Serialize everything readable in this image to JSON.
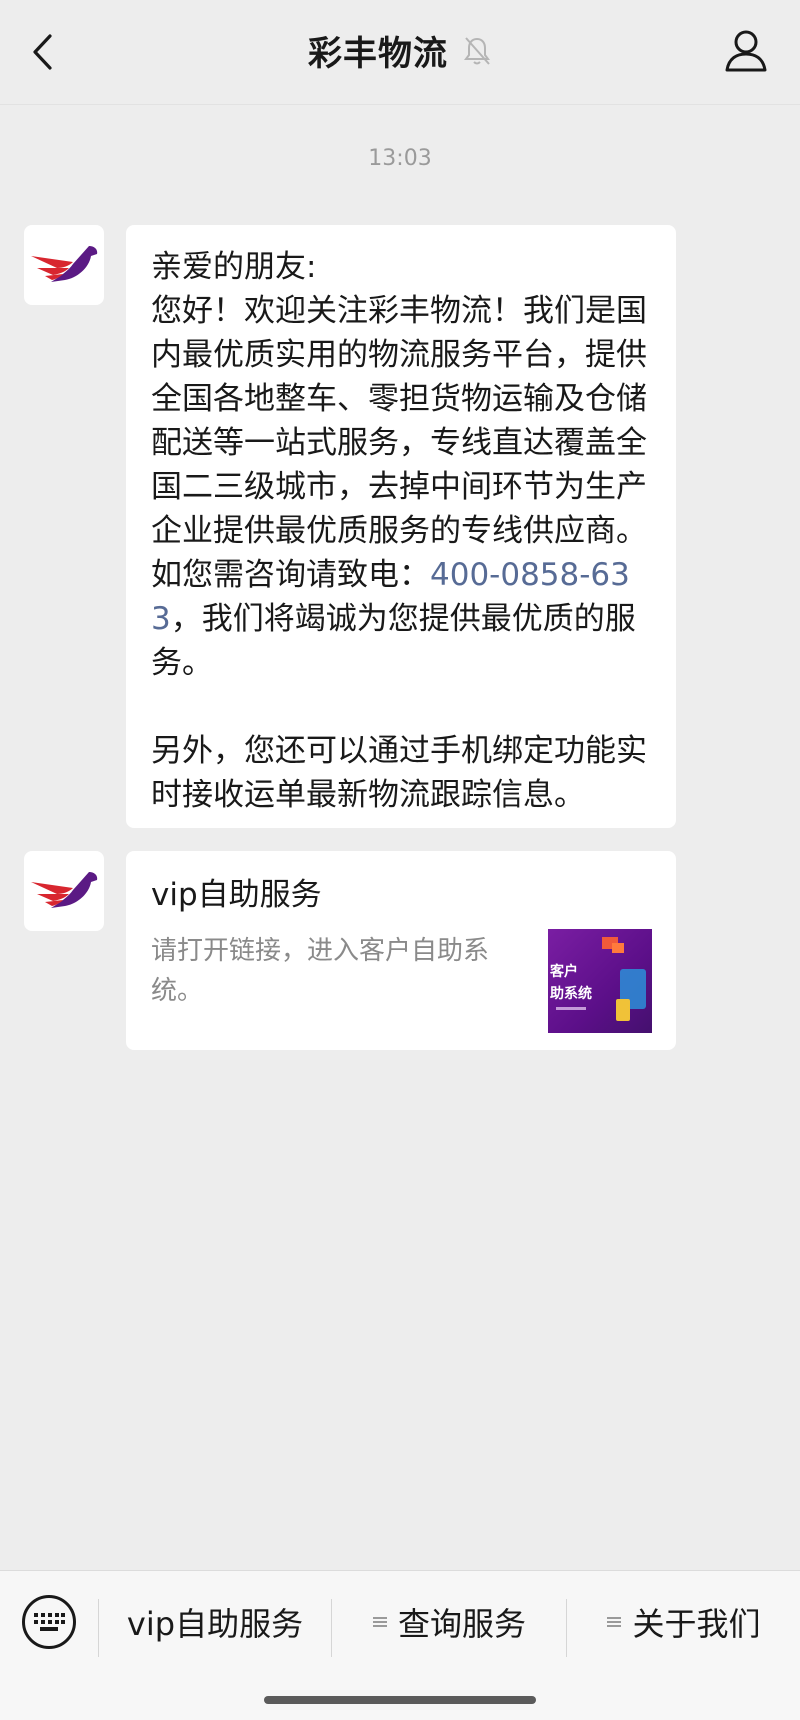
{
  "header": {
    "title": "彩丰物流",
    "back_icon": "chevron-left-icon",
    "mute_icon": "bell-muted-icon",
    "profile_icon": "person-icon"
  },
  "chat": {
    "timestamp": "13:03",
    "message1": {
      "greeting": "亲爱的朋友:",
      "body_before": "您好！欢迎关注彩丰物流！我们是国内最优质实用的物流服务平台，提供全国各地整车、零担货物运输及仓储配送等一站式服务，专线直达覆盖全国二三级城市，去掉中间环节为生产企业提供最优质服务的专线供应商。如您需咨询请致电：",
      "phone": "400-0858-633",
      "body_after": "，我们将竭诚为您提供最优质的服务。",
      "paragraph2": "另外，您还可以通过手机绑定功能实时接收运单最新物流跟踪信息。"
    },
    "card": {
      "title": "vip自助服务",
      "description": "请打开链接，进入客户自助系统。",
      "thumb_line1": "客户",
      "thumb_line2": "助系统"
    }
  },
  "menu": {
    "keyboard_icon": "keyboard-icon",
    "items": [
      {
        "label": "vip自助服务"
      },
      {
        "label": "查询服务"
      },
      {
        "label": "关于我们"
      }
    ]
  },
  "colors": {
    "background": "#ededed",
    "link": "#576b95",
    "brand_red": "#d8262f",
    "brand_purple": "#5b1a84"
  }
}
